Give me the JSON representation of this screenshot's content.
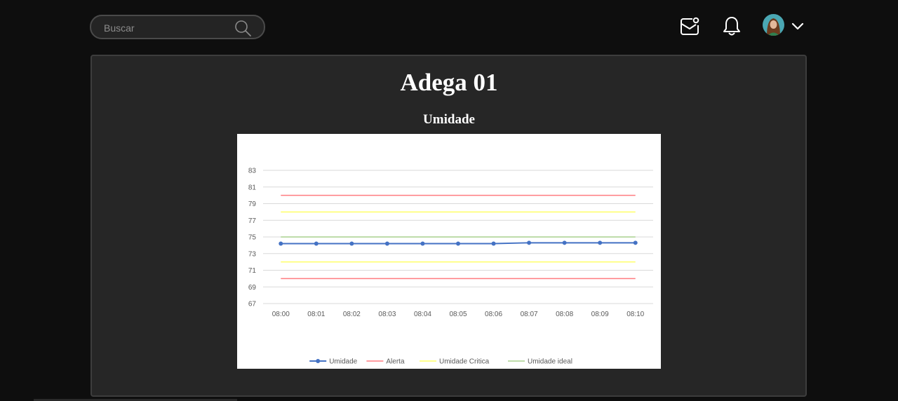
{
  "header": {
    "search": {
      "placeholder": "Buscar",
      "value": ""
    },
    "icons": [
      "search-icon",
      "mail-notification-icon",
      "bell-icon",
      "chevron-down-icon"
    ]
  },
  "page": {
    "title": "Adega 01"
  },
  "chart": {
    "title": "Umidade"
  },
  "colors": {
    "background": "#0e0e0e",
    "card": "#262626",
    "umidade": "#4472c4",
    "alerta": "#ff7c80",
    "critica": "#ffff66",
    "ideal": "#a9d18e"
  },
  "chart_data": {
    "type": "line",
    "title": "Umidade",
    "categories": [
      "08:00",
      "08:01",
      "08:02",
      "08:03",
      "08:04",
      "08:05",
      "08:06",
      "08:07",
      "08:08",
      "08:09",
      "08:10"
    ],
    "ylim": [
      67,
      83
    ],
    "yticks": [
      67,
      69,
      71,
      73,
      75,
      77,
      79,
      81,
      83
    ],
    "grid": true,
    "legend_position": "bottom",
    "series": [
      {
        "name": "Umidade",
        "color": "#4472c4",
        "markers": true,
        "values": [
          74.2,
          74.2,
          74.2,
          74.2,
          74.2,
          74.2,
          74.2,
          74.3,
          74.3,
          74.3,
          74.3
        ]
      },
      {
        "name": "Alerta",
        "color": "#ff7c80",
        "markers": false,
        "values": [
          80,
          80,
          80,
          80,
          80,
          80,
          80,
          80,
          80,
          80,
          80
        ]
      },
      {
        "name": "Alerta",
        "color": "#ff7c80",
        "markers": false,
        "legend": false,
        "values": [
          70,
          70,
          70,
          70,
          70,
          70,
          70,
          70,
          70,
          70,
          70
        ]
      },
      {
        "name": "Umidade Critica",
        "color": "#ffff66",
        "markers": false,
        "values": [
          78,
          78,
          78,
          78,
          78,
          78,
          78,
          78,
          78,
          78,
          78
        ]
      },
      {
        "name": "Umidade Critica",
        "color": "#ffff66",
        "markers": false,
        "legend": false,
        "values": [
          72,
          72,
          72,
          72,
          72,
          72,
          72,
          72,
          72,
          72,
          72
        ]
      },
      {
        "name": "Umidade ideal",
        "color": "#a9d18e",
        "markers": false,
        "values": [
          75,
          75,
          75,
          75,
          75,
          75,
          75,
          75,
          75,
          75,
          75
        ]
      }
    ]
  }
}
